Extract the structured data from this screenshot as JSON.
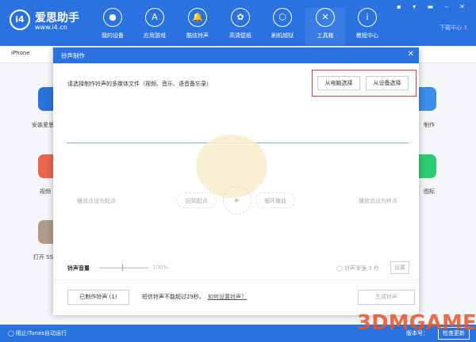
{
  "app": {
    "brand": "爱思助手",
    "url": "www.i4.cn",
    "logo": "i4"
  },
  "nav": [
    {
      "label": "我的设备",
      "icon": ""
    },
    {
      "label": "应用游戏",
      "icon": "A"
    },
    {
      "label": "酷炫铃声",
      "icon": "🔔"
    },
    {
      "label": "高清壁纸",
      "icon": "✿"
    },
    {
      "label": "刷机越狱",
      "icon": "⬡"
    },
    {
      "label": "工具箱",
      "icon": "✕"
    },
    {
      "label": "教程中心",
      "icon": "i"
    }
  ],
  "window_controls": "▪ ▾ ▬ – ✕",
  "download_center": "下载中心 ⇩",
  "device_tab": "iPhone",
  "background_tools": {
    "left": [
      "安装爱思",
      "视频",
      "打开 SS"
    ],
    "right": [
      "制作",
      "图标"
    ]
  },
  "dialog": {
    "title": "铃声制作",
    "close": "✕",
    "prompt": "请选择制作铃声的多媒体文件（视频、音乐、语音备忘录）",
    "from_pc": "从电脑选择",
    "from_device": "从设备选择",
    "set_start": "播放点设为起点",
    "back_to_start": "回到起点",
    "loop": "循环播放",
    "set_end": "播放点设为终点",
    "play": "▶",
    "volume_label": "铃声音量",
    "volume_pct": "100%",
    "volume_value": 50,
    "fade": "铃声渐强 3 秒",
    "settings": "设置",
    "made": "已制作铃声 (1)",
    "note": "短信铃声不能超过29秒。",
    "howto": "如何设置铃声？",
    "generate": "生成铃声"
  },
  "status": {
    "itunes": "◯ 阻止iTunes自动运行",
    "version": "版本号：",
    "update": "检查更新"
  },
  "watermark": "3DMGAME",
  "colors": {
    "primary": "#2a72e0",
    "highlight": "#e53935"
  }
}
